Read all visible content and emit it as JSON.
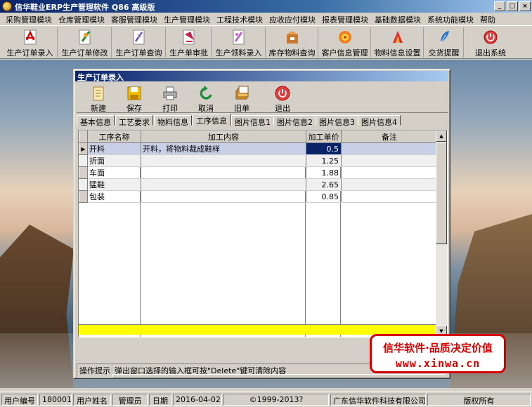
{
  "window": {
    "title": "信华鞋业ERP生产管理软件  Q86 高级版",
    "min": "_",
    "max": "□",
    "close": "×"
  },
  "menu": [
    "采购管理模块",
    "仓库管理模块",
    "客服管理模块",
    "生产管理模块",
    "工程技术模块",
    "应收应付模块",
    "报表管理模块",
    "基础数据模块",
    "系统功能模块",
    "帮助"
  ],
  "toolbar": [
    "生产订单录入",
    "生产订单修改",
    "生产订单查询",
    "生产单审批",
    "生产领料录入",
    "库存物料查询",
    "客户信息管理",
    "物料信息设置",
    "交货提醒",
    "退出系统"
  ],
  "child": {
    "title": "生产订单录入",
    "buttons": [
      "新建",
      "保存",
      "打印",
      "取消",
      "旧单",
      "退出"
    ],
    "tabs": [
      "基本信息",
      "工艺要求",
      "物料信息",
      "工序信息",
      "图片信息1",
      "图片信息2",
      "图片信息3",
      "图片信息4"
    ],
    "active_tab": "工序信息",
    "columns": [
      "工序名称",
      "加工内容",
      "加工单价",
      "备注"
    ],
    "rows": [
      {
        "name": "开料",
        "content": "开料，将物料裁成鞋样",
        "price": "0.5",
        "note": ""
      },
      {
        "name": "折面",
        "content": "",
        "price": "1.25",
        "note": ""
      },
      {
        "name": "车面",
        "content": "",
        "price": "1.88",
        "note": ""
      },
      {
        "name": "猛鞋",
        "content": "",
        "price": "2.65",
        "note": ""
      },
      {
        "name": "包装",
        "content": "",
        "price": "0.85",
        "note": ""
      }
    ],
    "hint_label": "操作提示",
    "hint_text": "弹出窗口选择的输入框可按\"Delete\"键可清除内容"
  },
  "promo": {
    "line1": "信华软件·品质决定价值",
    "line2": "www.xinwa.cn"
  },
  "status": {
    "user_no_label": "用户编号",
    "user_no": "180001",
    "user_name_label": "用户姓名",
    "user_name": "管理员",
    "date_label": "日期",
    "date": "2016-04-02",
    "copyright": "©1999-2013?",
    "company": "广东信华软件科技有限公司",
    "rights": "版权所有"
  },
  "colors": {
    "title_bar": "#0a246a",
    "sum_row": "#ffff00",
    "promo_red": "#d40000"
  }
}
